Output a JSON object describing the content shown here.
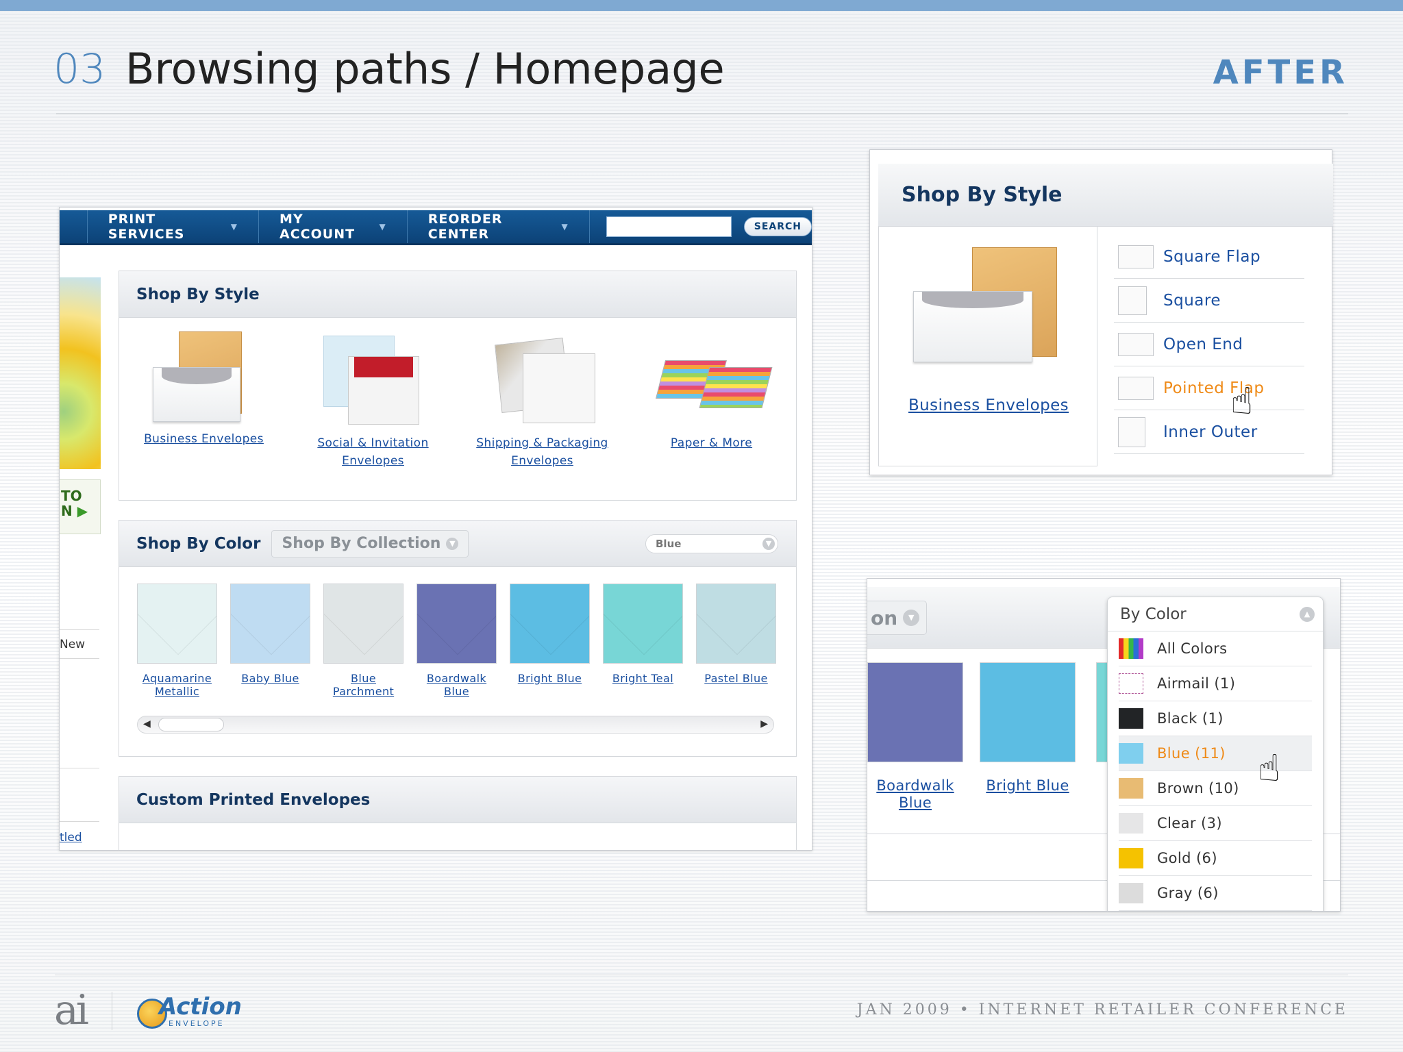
{
  "slide": {
    "number": "03",
    "title": "Browsing paths / Homepage",
    "tag": "AFTER",
    "footer": "JAN 2009 • INTERNET RETAILER CONFERENCE",
    "logo_ai": "ai",
    "logo_action_word": "Action",
    "logo_action_sub": "ENVELOPE"
  },
  "nav": {
    "items": [
      {
        "label": "PRINT SERVICES"
      },
      {
        "label": "MY ACCOUNT"
      },
      {
        "label": "REORDER CENTER"
      }
    ],
    "search_button": "SEARCH",
    "search_value": ""
  },
  "left_rail": {
    "promo_text_1": "TO",
    "promo_text_2": "N",
    "new_label": "New",
    "bottom_link": "tled"
  },
  "shop_by_style": {
    "title": "Shop By Style",
    "items": [
      {
        "label": "Business Envelopes"
      },
      {
        "label": "Social & Invitation Envelopes"
      },
      {
        "label": "Shipping & Packaging Envelopes"
      },
      {
        "label": "Paper & More"
      }
    ]
  },
  "shop_by_color": {
    "title": "Shop By Color",
    "tab_collection": "Shop By Collection",
    "select_value": "Blue",
    "swatches": [
      {
        "label": "Aquamarine Metallic",
        "color": "#e4f2f2"
      },
      {
        "label": "Baby Blue",
        "color": "#bfdcf2"
      },
      {
        "label": "Blue Parchment",
        "color": "#e0e5e6"
      },
      {
        "label": "Boardwalk Blue",
        "color": "#6a72b3"
      },
      {
        "label": "Bright Blue",
        "color": "#5cbde3"
      },
      {
        "label": "Bright Teal",
        "color": "#78d6d6"
      },
      {
        "label": "Pastel Blue",
        "color": "#bfdde3"
      }
    ]
  },
  "custom_printed": {
    "title": "Custom Printed Envelopes"
  },
  "inset_style": {
    "title": "Shop By Style",
    "featured": "Business Envelopes",
    "items": [
      {
        "label": "Square Flap"
      },
      {
        "label": "Square"
      },
      {
        "label": "Open End"
      },
      {
        "label": "Pointed Flap"
      },
      {
        "label": "Inner Outer"
      }
    ],
    "active_index": 3
  },
  "inset_color": {
    "tab_fragment": "on",
    "swatches": [
      {
        "label": "Boardwalk Blue",
        "color": "#6a72b3"
      },
      {
        "label": "Bright Blue",
        "color": "#5cbde3"
      }
    ],
    "dropdown_title": "By Color",
    "options": [
      {
        "label": "All Colors",
        "color": "rainbow"
      },
      {
        "label": "Airmail (1)",
        "color": "airmail"
      },
      {
        "label": "Black (1)",
        "color": "#222426"
      },
      {
        "label": "Blue (11)",
        "color": "#7fcfee"
      },
      {
        "label": "Brown (10)",
        "color": "#e8bb73"
      },
      {
        "label": "Clear (3)",
        "color": "#e6e6e7"
      },
      {
        "label": "Gold (6)",
        "color": "#f5c200"
      },
      {
        "label": "Gray (6)",
        "color": "#dcdcdc"
      }
    ],
    "active_index": 3
  }
}
